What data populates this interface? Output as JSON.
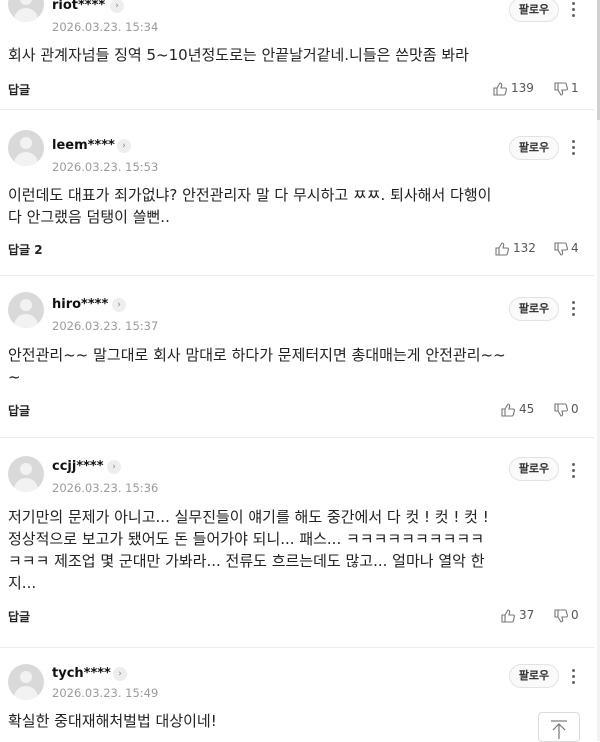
{
  "comments": [
    {
      "user": "riot****",
      "date": "2026.03.23. 15:34",
      "follow_label": "팔로우",
      "lines": [
        "회사 관계자넘들 징역 5~10년정도로는 안끝날거같네.니들은 쓴맛좀 봐라"
      ],
      "reply_label": "답글",
      "likes": "139",
      "dislikes": "1"
    },
    {
      "user": "leem****",
      "date": "2026.03.23. 15:53",
      "follow_label": "팔로우",
      "lines": [
        "이런데도 대표가 죄가없냐? 안전관리자 말 다 무시하고 ㅉㅉ. 퇴사해서 다행이",
        "다 안그랬음 덤탱이 쓸뻔.."
      ],
      "reply_label": "답글 2",
      "likes": "132",
      "dislikes": "4"
    },
    {
      "user": "hiro****",
      "date": "2026.03.23. 15:37",
      "follow_label": "팔로우",
      "lines": [
        "안전관리~~ 말그대로 회사 맘대로 하다가 문제터지면 총대매는게 안전관리~~",
        "~"
      ],
      "reply_label": "답글",
      "likes": "45",
      "dislikes": "0"
    },
    {
      "user": "ccjj****",
      "date": "2026.03.23. 15:36",
      "follow_label": "팔로우",
      "lines": [
        "저기만의 문제가 아니고... 실무진들이 얘기를 해도 중간에서 다 컷 ! 컷 ! 컷 !",
        "정상적으로 보고가 됐어도 돈 들어가야 되니... 패스... ㅋㅋㅋㅋㅋㅋㅋㅋㅋㅋ",
        "ㅋㅋㅋ 제조업 몇 군대만 가봐라... 전류도 흐르는데도 많고... 얼마나 열악 한",
        "지..."
      ],
      "reply_label": "답글",
      "likes": "37",
      "dislikes": "0"
    },
    {
      "user": "tych****",
      "date": "2026.03.23. 15:49",
      "follow_label": "팔로우",
      "lines": [
        "확실한 중대재해처벌법 대상이네!"
      ],
      "reply_label": "",
      "likes": "",
      "dislikes": ""
    }
  ],
  "icons": {
    "info": "info-icon",
    "more": "more-vertical-icon",
    "like": "thumbs-up-icon",
    "dislike": "thumbs-down-icon",
    "top": "arrow-up-icon"
  }
}
